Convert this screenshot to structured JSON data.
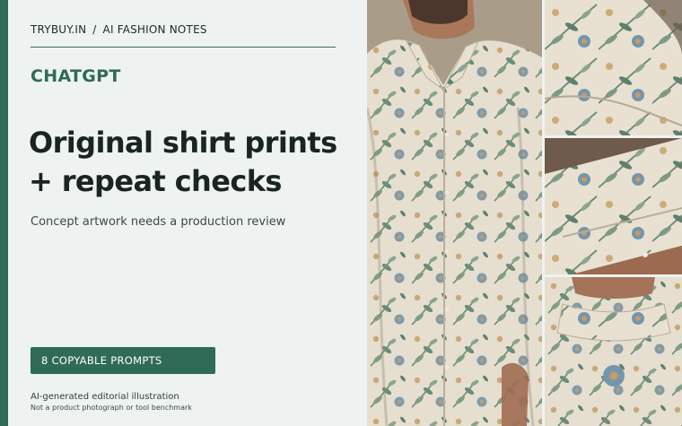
{
  "header": {
    "brand": "TRYBUY.IN",
    "separator": "/",
    "section": "AI FASHION NOTES"
  },
  "source": "CHATGPT",
  "headline": {
    "line1": "Original shirt prints",
    "line2": "+ repeat checks"
  },
  "subtitle": "Concept artwork needs a production review",
  "cta_label": "8 COPYABLE PROMPTS",
  "disclaimer": {
    "line1": "AI-generated editorial illustration",
    "line2": "Not a product photograph or tool benchmark"
  },
  "colors": {
    "accent": "#2f6b57",
    "panel_bg": "#eef3f1",
    "text": "#1a2421"
  }
}
